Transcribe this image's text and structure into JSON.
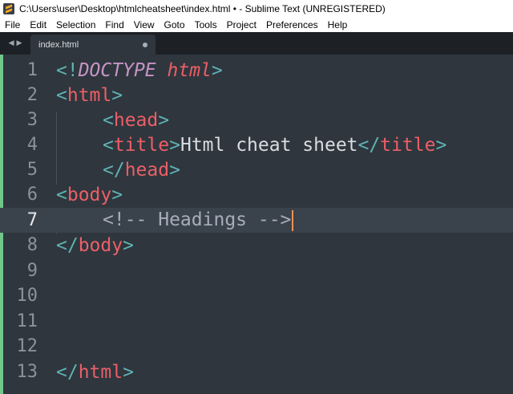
{
  "window": {
    "title": "C:\\Users\\user\\Desktop\\htmlcheatsheet\\index.html • - Sublime Text (UNREGISTERED)",
    "icon": "sublime-text-icon"
  },
  "menu": [
    "File",
    "Edit",
    "Selection",
    "Find",
    "View",
    "Goto",
    "Tools",
    "Project",
    "Preferences",
    "Help"
  ],
  "tabs": [
    {
      "label": "index.html",
      "dirty": true
    }
  ],
  "editor": {
    "current_line": 7,
    "line_numbers": [
      "1",
      "2",
      "3",
      "4",
      "5",
      "6",
      "7",
      "8",
      "9",
      "10",
      "11",
      "12",
      "13"
    ],
    "lines": {
      "l1": {
        "open": "<!",
        "doctype": "DOCTYPE",
        "space": " ",
        "html": "html",
        "close": ">"
      },
      "l2": {
        "open": "<",
        "tag": "html",
        "close": ">"
      },
      "l3": {
        "open": "<",
        "tag": "head",
        "close": ">"
      },
      "l4": {
        "open": "<",
        "tag": "title",
        "close": ">",
        "text": "Html cheat sheet",
        "open2": "</",
        "tag2": "title",
        "close2": ">"
      },
      "l5": {
        "open": "</",
        "tag": "head",
        "close": ">"
      },
      "l6": {
        "open": "<",
        "tag": "body",
        "close": ">"
      },
      "l7": {
        "comment": "<!-- Headings -->"
      },
      "l8": {
        "open": "</",
        "tag": "body",
        "close": ">"
      },
      "l13": {
        "open": "</",
        "tag": "html",
        "close": ">"
      }
    },
    "colors": {
      "background": "#2f363e",
      "punctuation": "#5fb3b3",
      "tag": "#ec5f67",
      "doctype": "#c594c5",
      "caret": "#f99157",
      "modified_bar": "#6fc78a"
    }
  }
}
